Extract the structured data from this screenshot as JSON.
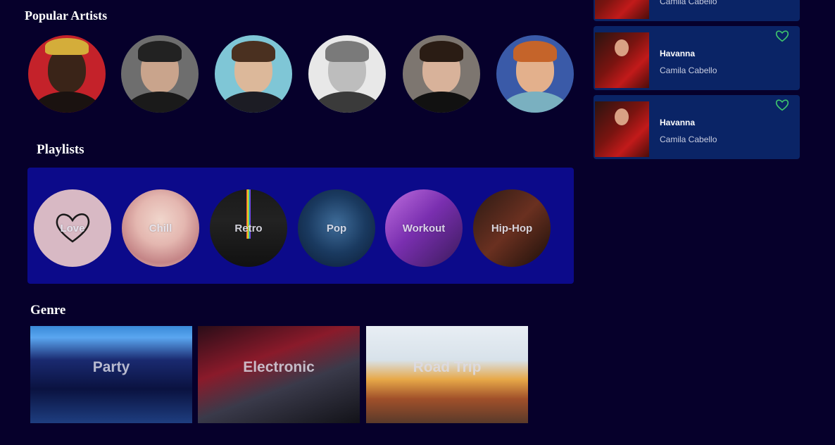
{
  "sections": {
    "artists_title": "Popular Artists",
    "playlists_title": "Playlists",
    "genre_title": "Genre"
  },
  "artists": [
    {
      "icon": "artist-avatar-1"
    },
    {
      "icon": "artist-avatar-2"
    },
    {
      "icon": "artist-avatar-3"
    },
    {
      "icon": "artist-avatar-4"
    },
    {
      "icon": "artist-avatar-5"
    },
    {
      "icon": "artist-avatar-6"
    }
  ],
  "playlists": [
    {
      "label": "Love"
    },
    {
      "label": "Chill"
    },
    {
      "label": "Retro"
    },
    {
      "label": "Pop"
    },
    {
      "label": "Workout"
    },
    {
      "label": "Hip-Hop"
    }
  ],
  "genres": [
    {
      "label": "Party"
    },
    {
      "label": "Electronic"
    },
    {
      "label": "Road Trip"
    }
  ],
  "songs": [
    {
      "title": "",
      "artist": "Camila Cabello"
    },
    {
      "title": "Havanna",
      "artist": "Camila Cabello"
    },
    {
      "title": "Havanna",
      "artist": "Camila Cabello"
    }
  ],
  "colors": {
    "background": "#06002b",
    "panel": "#0c0a8a",
    "card": "#0a2466",
    "heart": "#3ec46d"
  }
}
